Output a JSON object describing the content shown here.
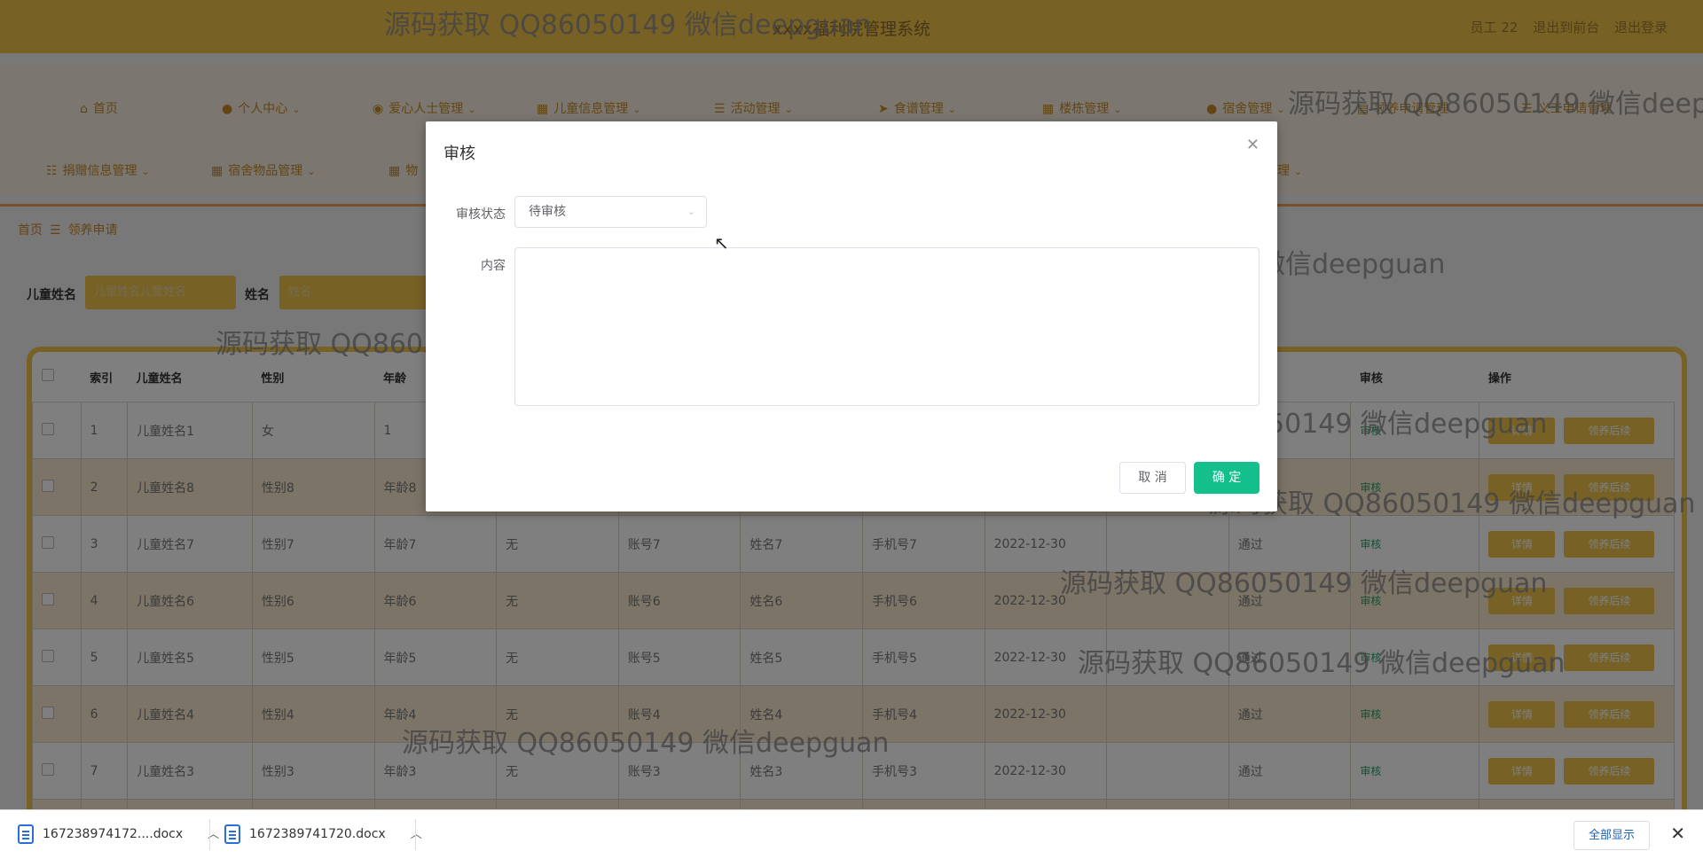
{
  "app": {
    "title": "xxxx福利院管理系统",
    "user": "员工 22",
    "back_front": "退出到前台",
    "logout": "退出登录"
  },
  "nav": {
    "row1": [
      {
        "label": "首页",
        "icon": "home-icon",
        "glyph": "⌂"
      },
      {
        "label": "个人中心",
        "icon": "user-icon",
        "glyph": "●"
      },
      {
        "label": "爱心人士管理",
        "icon": "location-icon",
        "glyph": "◉"
      },
      {
        "label": "儿童信息管理",
        "icon": "grid-icon",
        "glyph": "▦"
      },
      {
        "label": "活动管理",
        "icon": "list-icon",
        "glyph": "☰"
      },
      {
        "label": "食谱管理",
        "icon": "send-icon",
        "glyph": "➤"
      },
      {
        "label": "楼栋管理",
        "icon": "apps-icon",
        "glyph": "▦"
      },
      {
        "label": "宿舍管理",
        "icon": "person-icon",
        "glyph": "●"
      },
      {
        "label": "领养申请管理",
        "icon": "calendar-icon",
        "glyph": "▤"
      },
      {
        "label": "义工申请管理",
        "icon": "menu-icon",
        "glyph": "☰"
      }
    ],
    "row2": [
      {
        "label": "捐赠信息管理",
        "icon": "sliders-icon",
        "glyph": "☷"
      },
      {
        "label": "宿舍物品管理",
        "icon": "apps-icon",
        "glyph": "▦"
      },
      {
        "label": "物",
        "icon": "apps-icon",
        "glyph": "▦"
      },
      {
        "label": "理",
        "icon": "apps-icon",
        "glyph": ""
      }
    ]
  },
  "breadcrumb": {
    "home": "首页",
    "sep": "☰",
    "current": "领养申请"
  },
  "search": {
    "child_label": "儿童姓名",
    "child_placeholder": "儿童姓名儿童姓名",
    "name_label": "姓名",
    "name_placeholder": "姓名"
  },
  "table": {
    "headers": [
      "索引",
      "儿童姓名",
      "性别",
      "年龄",
      "",
      "",
      "",
      "",
      "",
      "",
      "审核",
      "操作"
    ],
    "rows": [
      {
        "index": "1",
        "child": "儿童姓名1",
        "gender": "女",
        "age": "1",
        "health": "",
        "account": "",
        "name": "",
        "phone": "",
        "date": "",
        "reply": "",
        "state": "",
        "audit": "审核"
      },
      {
        "index": "2",
        "child": "儿童姓名8",
        "gender": "性别8",
        "age": "年龄8",
        "health": "",
        "account": "",
        "name": "",
        "phone": "",
        "date": "",
        "reply": "",
        "state": "",
        "audit": "审核"
      },
      {
        "index": "3",
        "child": "儿童姓名7",
        "gender": "性别7",
        "age": "年龄7",
        "health": "无",
        "account": "账号7",
        "name": "姓名7",
        "phone": "手机号7",
        "date": "2022-12-30",
        "reply": "",
        "state": "通过",
        "audit": "审核"
      },
      {
        "index": "4",
        "child": "儿童姓名6",
        "gender": "性别6",
        "age": "年龄6",
        "health": "无",
        "account": "账号6",
        "name": "姓名6",
        "phone": "手机号6",
        "date": "2022-12-30",
        "reply": "",
        "state": "通过",
        "audit": "审核"
      },
      {
        "index": "5",
        "child": "儿童姓名5",
        "gender": "性别5",
        "age": "年龄5",
        "health": "无",
        "account": "账号5",
        "name": "姓名5",
        "phone": "手机号5",
        "date": "2022-12-30",
        "reply": "",
        "state": "通过",
        "audit": "审核"
      },
      {
        "index": "6",
        "child": "儿童姓名4",
        "gender": "性别4",
        "age": "年龄4",
        "health": "无",
        "account": "账号4",
        "name": "姓名4",
        "phone": "手机号4",
        "date": "2022-12-30",
        "reply": "",
        "state": "通过",
        "audit": "审核"
      },
      {
        "index": "7",
        "child": "儿童姓名3",
        "gender": "性别3",
        "age": "年龄3",
        "health": "无",
        "account": "账号3",
        "name": "姓名3",
        "phone": "手机号3",
        "date": "2022-12-30",
        "reply": "",
        "state": "通过",
        "audit": "审核"
      },
      {
        "index": "8",
        "child": "儿童姓名2",
        "gender": "性别2",
        "age": "年龄2",
        "health": "无",
        "account": "账号2",
        "name": "姓名2",
        "phone": "手机号2",
        "date": "2022-12-30",
        "reply": "",
        "state": "通过",
        "audit": "审核"
      }
    ],
    "detail_btn": "详情",
    "followup_btn": "领养后续"
  },
  "dialog": {
    "title": "审核",
    "status_label": "审核状态",
    "status_value": "待审核",
    "content_label": "内容",
    "content_value": "",
    "cancel": "取 消",
    "confirm": "确 定"
  },
  "watermark": "源码获取 QQ86050149 微信deepguan",
  "downloads": {
    "file1": "167238974172....docx",
    "file2": "1672389741720.docx",
    "show_all": "全部显示"
  },
  "colors": {
    "topbar": "#f0c24b",
    "nav_text": "#c58b26",
    "confirm": "#13c08b",
    "audit_link": "#27a36d"
  }
}
